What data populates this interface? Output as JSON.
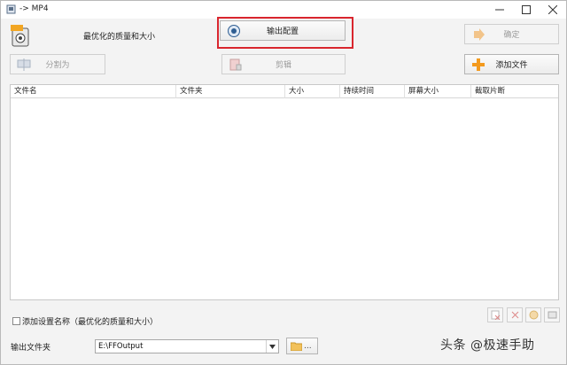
{
  "window": {
    "title": "-> MP4"
  },
  "header": {
    "profile_label": "最优化的质量和大小"
  },
  "toolbar": {
    "output_config": "输出配置",
    "confirm": "确定",
    "split": "分割为",
    "clip": "剪辑",
    "add_file": "添加文件"
  },
  "table": {
    "columns": [
      "文件名",
      "文件夹",
      "大小",
      "持续时间",
      "屏幕大小",
      "截取片断"
    ],
    "rows": []
  },
  "options": {
    "add_profile_name": "添加设置名称（最优化的质量和大小）",
    "add_profile_name_checked": false
  },
  "output": {
    "label": "输出文件夹",
    "folder": "E:\\FFOutput",
    "browse_label": "..."
  },
  "watermark": "头条 @极速手助",
  "colors": {
    "highlight": "#d9262e",
    "add_icon": "#f39a1e"
  }
}
